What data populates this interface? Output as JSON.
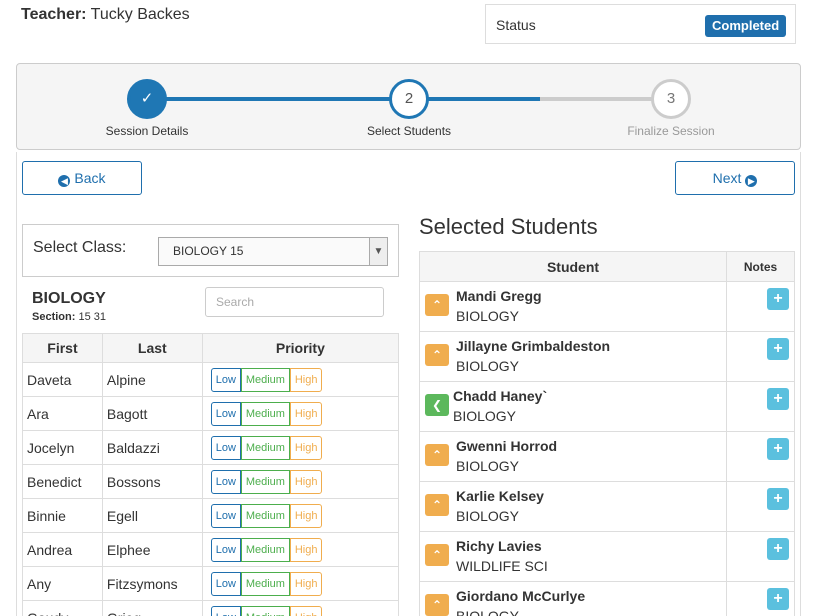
{
  "header": {
    "teacher_label": "Teacher:",
    "teacher_name": "Tucky Backes",
    "status_label": "Status",
    "status_value": "Completed"
  },
  "wizard": {
    "steps": [
      {
        "number": "✓",
        "label": "Session Details",
        "state": "done"
      },
      {
        "number": "2",
        "label": "Select Students",
        "state": "active"
      },
      {
        "number": "3",
        "label": "Finalize Session",
        "state": "pending"
      }
    ]
  },
  "nav": {
    "back_label": "Back",
    "next_label": "Next"
  },
  "class_picker": {
    "label": "Select Class:",
    "selected": "BIOLOGY 15"
  },
  "class_info": {
    "subject": "BIOLOGY",
    "section_label": "Section:",
    "section_value": "15 31",
    "search_placeholder": "Search"
  },
  "roster": {
    "headers": [
      "First",
      "Last",
      "Priority"
    ],
    "priority_options": [
      "Low",
      "Medium",
      "High"
    ],
    "rows": [
      {
        "first": "Daveta",
        "last": "Alpine"
      },
      {
        "first": "Ara",
        "last": "Bagott"
      },
      {
        "first": "Jocelyn",
        "last": "Baldazzi"
      },
      {
        "first": "Benedict",
        "last": "Bossons"
      },
      {
        "first": "Binnie",
        "last": "Egell"
      },
      {
        "first": "Andrea",
        "last": "Elphee"
      },
      {
        "first": "Any",
        "last": "Fitzsymons"
      },
      {
        "first": "Gaudy",
        "last": "Grieg"
      }
    ]
  },
  "selected": {
    "title": "Selected Students",
    "headers": [
      "Student",
      "Notes"
    ],
    "rows": [
      {
        "name": "Mandi Gregg",
        "class": "BIOLOGY",
        "action": "up"
      },
      {
        "name": "Jillayne Grimbaldeston",
        "class": "BIOLOGY",
        "action": "up"
      },
      {
        "name": "Chadd Haney`",
        "class": "BIOLOGY",
        "action": "back"
      },
      {
        "name": "Gwenni Horrod",
        "class": "BIOLOGY",
        "action": "up"
      },
      {
        "name": "Karlie Kelsey",
        "class": "BIOLOGY",
        "action": "up"
      },
      {
        "name": "Richy Lavies",
        "class": "WILDLIFE SCI",
        "action": "up"
      },
      {
        "name": "Giordano McCurlye",
        "class": "BIOLOGY",
        "action": "up"
      }
    ]
  },
  "colors": {
    "primary": "#1f6fad",
    "warning": "#f0ad4e",
    "success": "#5cb85c",
    "info": "#5bc0de"
  }
}
